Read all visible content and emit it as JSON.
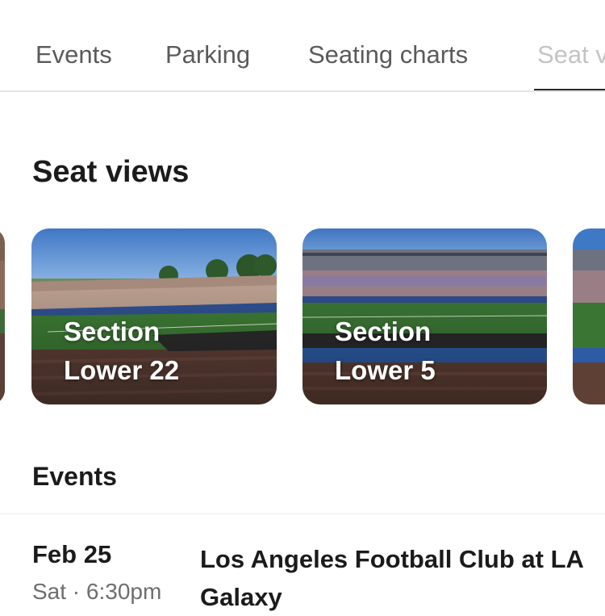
{
  "tabs": [
    {
      "label": "Events"
    },
    {
      "label": "Parking"
    },
    {
      "label": "Seating charts"
    },
    {
      "label": "Seat views"
    }
  ],
  "seat_views": {
    "title": "Seat views",
    "cards": [
      {
        "line1": "Section",
        "line2": "Lower 22"
      },
      {
        "line1": "Section",
        "line2": "Lower 5"
      }
    ]
  },
  "events": {
    "title": "Events",
    "items": [
      {
        "date": "Feb 25",
        "time": "Sat · 6:30pm",
        "name": "Los Angeles Football Club at LA Galaxy"
      }
    ]
  },
  "colors": {
    "tab_text": "#5a5a5a",
    "tab_active_underline": "#2a2a2a",
    "heading": "#1b1b1b",
    "muted_text": "#6e6e6e"
  }
}
